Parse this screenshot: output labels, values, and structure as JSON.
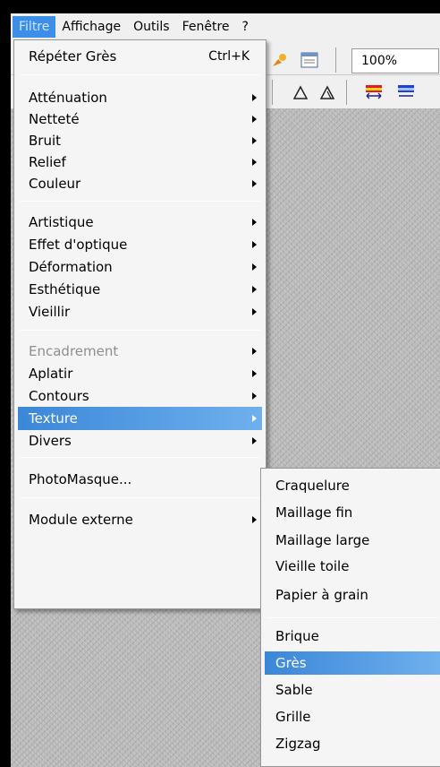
{
  "menubar": {
    "items": [
      "Filtre",
      "Affichage",
      "Outils",
      "Fenêtre",
      "?"
    ],
    "active_index": 0
  },
  "toolbar": {
    "zoom_value": "100%"
  },
  "filtre_menu": {
    "repeat": {
      "label": "Répéter Grès",
      "shortcut": "Ctrl+K"
    },
    "group1": [
      "Atténuation",
      "Netteté",
      "Bruit",
      "Relief",
      "Couleur"
    ],
    "group2": [
      "Artistique",
      "Effet d'optique",
      "Déformation",
      "Esthétique",
      "Vieillir"
    ],
    "group3": [
      {
        "label": "Encadrement",
        "disabled": true
      },
      {
        "label": "Aplatir",
        "disabled": false
      },
      {
        "label": "Contours",
        "disabled": false
      },
      {
        "label": "Texture",
        "highlight": true
      },
      {
        "label": "Divers",
        "disabled": false
      }
    ],
    "photomasque": "PhotoMasque...",
    "module": "Module externe"
  },
  "texture_menu": {
    "group1": [
      "Craquelure",
      "Maillage fin",
      "Maillage large",
      "Vieille toile",
      "Papier à grain"
    ],
    "group2": [
      "Brique",
      "Grès",
      "Sable",
      "Grille",
      "Zigzag"
    ],
    "highlighted": "Grès"
  },
  "colors": {
    "highlight_start": "#3b87d8",
    "highlight_end": "#6fb0ee",
    "menu_bg": "#f5f5f5",
    "canvas": "#b9b9b9"
  }
}
